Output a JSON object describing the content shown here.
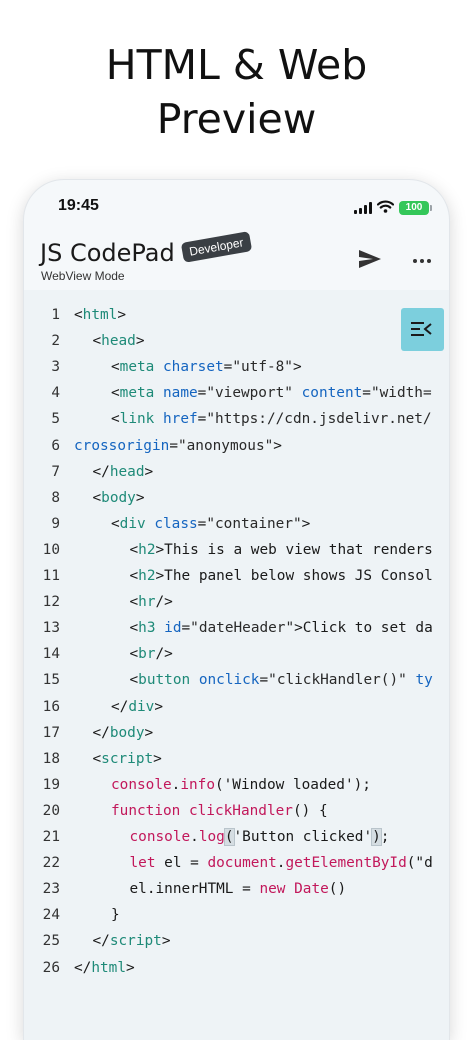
{
  "headline": {
    "line1": "HTML & Web",
    "line2": "Preview"
  },
  "status_bar": {
    "time": "19:45",
    "battery": "100"
  },
  "appbar": {
    "title": "JS CodePad",
    "subtitle": "WebView Mode",
    "badge": "Developer"
  },
  "icons": {
    "send": "send-icon",
    "more": "more-icon",
    "panel_toggle": "panel-collapse-icon",
    "signal": "cellular-signal-icon",
    "wifi": "wifi-icon",
    "battery": "battery-icon"
  },
  "colors": {
    "tag": "#1e8a78",
    "attribute": "#1565c0",
    "keyword": "#c2185b",
    "battery": "#34c759",
    "panel_toggle": "#7ccfdd",
    "editor_bg": "#eef3f6"
  },
  "code": [
    {
      "n": "1",
      "indent": 0,
      "tokens": [
        {
          "t": "<",
          "k": "p"
        },
        {
          "t": "html",
          "k": "tag"
        },
        {
          "t": ">",
          "k": "p"
        }
      ]
    },
    {
      "n": "2",
      "indent": 1,
      "tokens": [
        {
          "t": "<",
          "k": "p"
        },
        {
          "t": "head",
          "k": "tag"
        },
        {
          "t": ">",
          "k": "p"
        }
      ]
    },
    {
      "n": "3",
      "indent": 2,
      "tokens": [
        {
          "t": "<",
          "k": "p"
        },
        {
          "t": "meta",
          "k": "tag"
        },
        {
          "t": " ",
          "k": "p"
        },
        {
          "t": "charset",
          "k": "attr"
        },
        {
          "t": "=",
          "k": "p"
        },
        {
          "t": "\"utf-8\"",
          "k": "str"
        },
        {
          "t": ">",
          "k": "p"
        }
      ]
    },
    {
      "n": "4",
      "indent": 2,
      "tokens": [
        {
          "t": "<",
          "k": "p"
        },
        {
          "t": "meta",
          "k": "tag"
        },
        {
          "t": " ",
          "k": "p"
        },
        {
          "t": "name",
          "k": "attr"
        },
        {
          "t": "=",
          "k": "p"
        },
        {
          "t": "\"viewport\"",
          "k": "str"
        },
        {
          "t": " ",
          "k": "p"
        },
        {
          "t": "content",
          "k": "attr"
        },
        {
          "t": "=",
          "k": "p"
        },
        {
          "t": "\"width=",
          "k": "str"
        }
      ]
    },
    {
      "n": "5",
      "indent": 2,
      "tokens": [
        {
          "t": "<",
          "k": "p"
        },
        {
          "t": "link",
          "k": "tag"
        },
        {
          "t": " ",
          "k": "p"
        },
        {
          "t": "href",
          "k": "attr"
        },
        {
          "t": "=",
          "k": "p"
        },
        {
          "t": "\"https://cdn.jsdelivr.net/",
          "k": "str"
        }
      ]
    },
    {
      "n": "6",
      "indent": -1,
      "tokens": [
        {
          "t": "crossorigin",
          "k": "attr"
        },
        {
          "t": "=",
          "k": "p"
        },
        {
          "t": "\"anonymous\"",
          "k": "str"
        },
        {
          "t": ">",
          "k": "p"
        }
      ]
    },
    {
      "n": "7",
      "indent": 1,
      "tokens": [
        {
          "t": "</",
          "k": "p"
        },
        {
          "t": "head",
          "k": "tag"
        },
        {
          "t": ">",
          "k": "p"
        }
      ]
    },
    {
      "n": "8",
      "indent": 1,
      "tokens": [
        {
          "t": "<",
          "k": "p"
        },
        {
          "t": "body",
          "k": "tag"
        },
        {
          "t": ">",
          "k": "p"
        }
      ]
    },
    {
      "n": "9",
      "indent": 2,
      "tokens": [
        {
          "t": "<",
          "k": "p"
        },
        {
          "t": "div",
          "k": "tag"
        },
        {
          "t": " ",
          "k": "p"
        },
        {
          "t": "class",
          "k": "attr"
        },
        {
          "t": "=",
          "k": "p"
        },
        {
          "t": "\"container\"",
          "k": "str"
        },
        {
          "t": ">",
          "k": "p"
        }
      ]
    },
    {
      "n": "10",
      "indent": 3,
      "tokens": [
        {
          "t": "<",
          "k": "p"
        },
        {
          "t": "h2",
          "k": "tag"
        },
        {
          "t": ">This is a web view that renders",
          "k": "text"
        }
      ]
    },
    {
      "n": "11",
      "indent": 3,
      "tokens": [
        {
          "t": "<",
          "k": "p"
        },
        {
          "t": "h2",
          "k": "tag"
        },
        {
          "t": ">The panel below shows JS Consol",
          "k": "text"
        }
      ]
    },
    {
      "n": "12",
      "indent": 3,
      "tokens": [
        {
          "t": "<",
          "k": "p"
        },
        {
          "t": "hr",
          "k": "tag"
        },
        {
          "t": "/>",
          "k": "p"
        }
      ]
    },
    {
      "n": "13",
      "indent": 3,
      "tokens": [
        {
          "t": "<",
          "k": "p"
        },
        {
          "t": "h3",
          "k": "tag"
        },
        {
          "t": " ",
          "k": "p"
        },
        {
          "t": "id",
          "k": "attr"
        },
        {
          "t": "=",
          "k": "p"
        },
        {
          "t": "\"dateHeader\"",
          "k": "str"
        },
        {
          "t": ">Click to set da",
          "k": "text"
        }
      ]
    },
    {
      "n": "14",
      "indent": 3,
      "tokens": [
        {
          "t": "<",
          "k": "p"
        },
        {
          "t": "br",
          "k": "tag"
        },
        {
          "t": "/>",
          "k": "p"
        }
      ]
    },
    {
      "n": "15",
      "indent": 3,
      "tokens": [
        {
          "t": "<",
          "k": "p"
        },
        {
          "t": "button",
          "k": "tag"
        },
        {
          "t": " ",
          "k": "p"
        },
        {
          "t": "onclick",
          "k": "attr"
        },
        {
          "t": "=",
          "k": "p"
        },
        {
          "t": "\"clickHandler()\"",
          "k": "str"
        },
        {
          "t": " ",
          "k": "p"
        },
        {
          "t": "ty",
          "k": "attr"
        }
      ]
    },
    {
      "n": "16",
      "indent": 2,
      "tokens": [
        {
          "t": "</",
          "k": "p"
        },
        {
          "t": "div",
          "k": "tag"
        },
        {
          "t": ">",
          "k": "p"
        }
      ]
    },
    {
      "n": "17",
      "indent": 1,
      "tokens": [
        {
          "t": "</",
          "k": "p"
        },
        {
          "t": "body",
          "k": "tag"
        },
        {
          "t": ">",
          "k": "p"
        }
      ]
    },
    {
      "n": "18",
      "indent": 1,
      "tokens": [
        {
          "t": "<",
          "k": "p"
        },
        {
          "t": "script",
          "k": "tag"
        },
        {
          "t": ">",
          "k": "p"
        }
      ]
    },
    {
      "n": "19",
      "indent": 2,
      "tokens": [
        {
          "t": "console",
          "k": "obj"
        },
        {
          "t": ".",
          "k": "p"
        },
        {
          "t": "info",
          "k": "fn"
        },
        {
          "t": "('Window loaded');",
          "k": "p"
        }
      ]
    },
    {
      "n": "20",
      "indent": 2,
      "tokens": [
        {
          "t": "function",
          "k": "kw"
        },
        {
          "t": " ",
          "k": "p"
        },
        {
          "t": "clickHandler",
          "k": "fn"
        },
        {
          "t": "() {",
          "k": "p"
        }
      ]
    },
    {
      "n": "21",
      "indent": 3,
      "tokens": [
        {
          "t": "console",
          "k": "obj"
        },
        {
          "t": ".",
          "k": "p"
        },
        {
          "t": "log",
          "k": "fn"
        },
        {
          "t": "(",
          "k": "hl"
        },
        {
          "t": "'Button clicked'",
          "k": "p"
        },
        {
          "t": ")",
          "k": "hl"
        },
        {
          "t": ";",
          "k": "p"
        }
      ]
    },
    {
      "n": "22",
      "indent": 3,
      "tokens": [
        {
          "t": "let",
          "k": "kw"
        },
        {
          "t": " el = ",
          "k": "p"
        },
        {
          "t": "document",
          "k": "obj"
        },
        {
          "t": ".",
          "k": "p"
        },
        {
          "t": "getElementById",
          "k": "fn"
        },
        {
          "t": "(\"d",
          "k": "p"
        }
      ]
    },
    {
      "n": "23",
      "indent": 3,
      "tokens": [
        {
          "t": "el.innerHTML = ",
          "k": "p"
        },
        {
          "t": "new",
          "k": "kw"
        },
        {
          "t": " ",
          "k": "p"
        },
        {
          "t": "Date",
          "k": "fn"
        },
        {
          "t": "()",
          "k": "p"
        }
      ]
    },
    {
      "n": "24",
      "indent": 2,
      "tokens": [
        {
          "t": "}",
          "k": "p"
        }
      ]
    },
    {
      "n": "25",
      "indent": 1,
      "tokens": [
        {
          "t": "</",
          "k": "p"
        },
        {
          "t": "script",
          "k": "tag"
        },
        {
          "t": ">",
          "k": "p"
        }
      ]
    },
    {
      "n": "26",
      "indent": 0,
      "tokens": [
        {
          "t": "</",
          "k": "p"
        },
        {
          "t": "html",
          "k": "tag"
        },
        {
          "t": ">",
          "k": "p"
        }
      ]
    }
  ]
}
